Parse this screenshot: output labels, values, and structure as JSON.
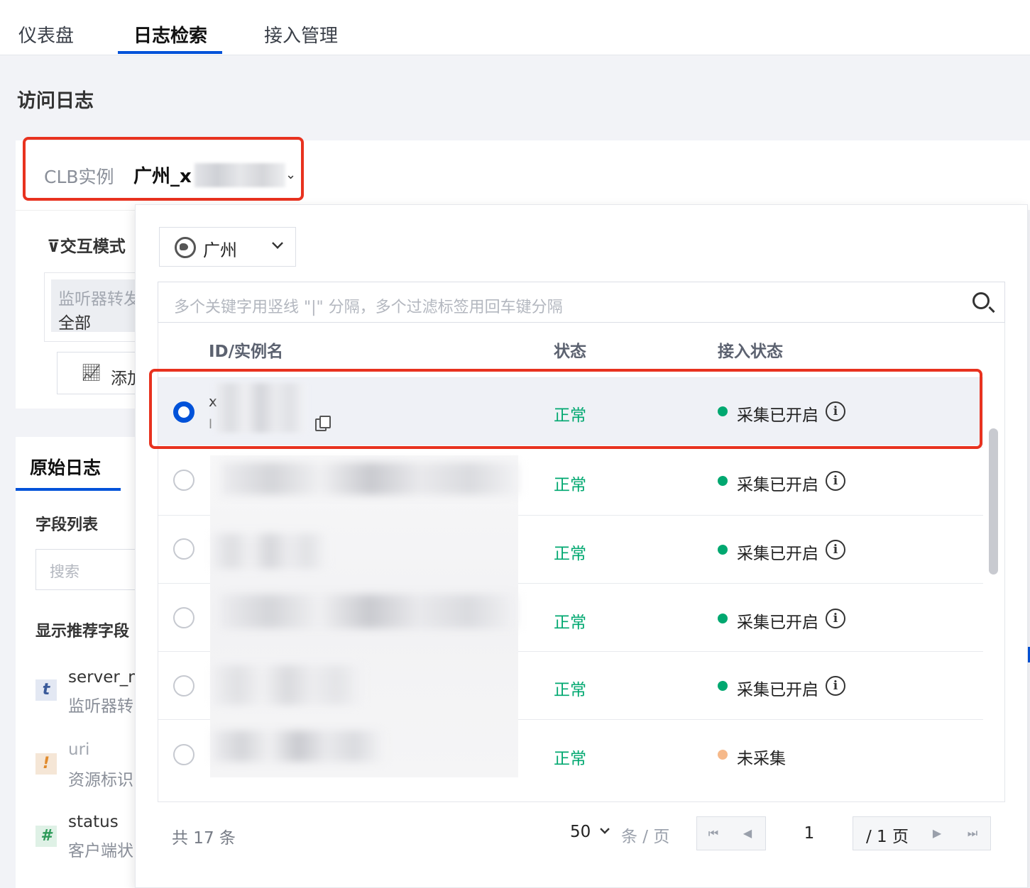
{
  "tabs": [
    "仪表盘",
    "日志检索",
    "接入管理"
  ],
  "page_title": "访问日志",
  "clb": {
    "label": "CLB实例",
    "value": "广州_x"
  },
  "left": {
    "interaction_mode": "交互模式",
    "listener_tag": "监听器转发",
    "listener_value": "全部",
    "add_chart": "添加",
    "raw_log_tab": "原始日志",
    "field_list": "字段列表",
    "search_placeholder": "搜索",
    "recommended": "显示推荐字段",
    "fields": [
      {
        "icon": "t",
        "name": "server_n",
        "desc": "监听器转"
      },
      {
        "icon": "!",
        "name": "uri",
        "desc": "资源标识"
      },
      {
        "icon": "#",
        "name": "status",
        "desc": "客户端状"
      }
    ]
  },
  "dropdown": {
    "region": "广州",
    "filter_placeholder": "多个关键字用竖线 \"|\" 分隔，多个过滤标签用回车键分隔",
    "columns": [
      "ID/实例名",
      "状态",
      "接入状态"
    ],
    "rows": [
      {
        "name": "x",
        "id": "l",
        "status": "正常",
        "collect": "采集已开启",
        "collect_color": "#00a870",
        "selected": true
      },
      {
        "name": "",
        "id": "",
        "status": "正常",
        "collect": "采集已开启",
        "collect_color": "#00a870",
        "selected": false
      },
      {
        "name": "",
        "id": "",
        "status": "正常",
        "collect": "采集已开启",
        "collect_color": "#00a870",
        "selected": false
      },
      {
        "name": "",
        "id": "",
        "status": "正常",
        "collect": "采集已开启",
        "collect_color": "#00a870",
        "selected": false
      },
      {
        "name": "",
        "id": "",
        "status": "正常",
        "collect": "采集已开启",
        "collect_color": "#00a870",
        "selected": false
      },
      {
        "name": "",
        "id": "",
        "status": "正常",
        "collect": "未采集",
        "collect_color": "#f6b98a",
        "selected": false
      }
    ],
    "footer": {
      "total": "共 17 条",
      "page_size": "50",
      "per_page": "条 / 页",
      "current_page": "1",
      "total_pages": "/ 1 页"
    }
  },
  "colors": {
    "accent": "#0052d9",
    "highlight": "#e8321f",
    "ok": "#00a870"
  }
}
